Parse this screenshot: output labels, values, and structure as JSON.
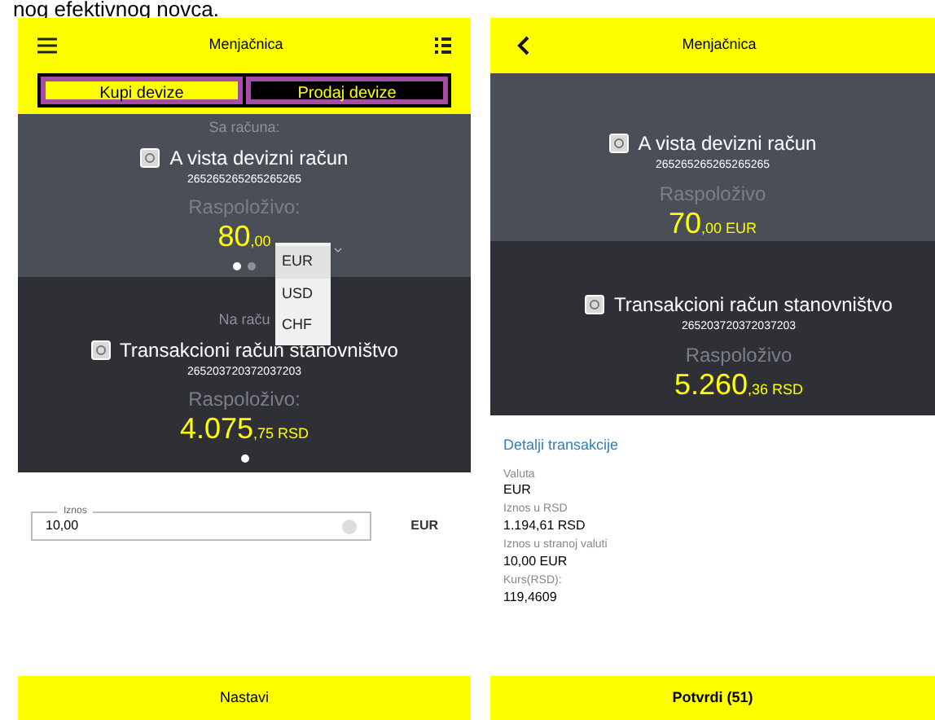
{
  "caption": "nog efektivnog novca.",
  "left": {
    "title": "Menjačnica",
    "tabs": [
      {
        "label": "Kupi devize",
        "selected": true
      },
      {
        "label": "Prodaj devize",
        "selected": false
      }
    ],
    "from": {
      "label": "Sa računa:",
      "name": "A vista devizni račun",
      "number": "265265265265265265",
      "available": "Raspoloživo:",
      "amount": "80",
      "decimals": ",00",
      "currency_dropdown": {
        "options": [
          {
            "label": "EUR",
            "selected": true
          },
          {
            "label": "USD",
            "selected": false
          },
          {
            "label": "CHF",
            "selected": false
          }
        ]
      },
      "pages": [
        {
          "selected": true
        },
        {
          "selected": false
        }
      ]
    },
    "to": {
      "label": "Na raču",
      "name": "Transakcioni račun stanovništvo",
      "number": "265203720372037203",
      "available": "Raspoloživo:",
      "amount": "4.075",
      "decimals": ",75 RSD",
      "pages": [
        {
          "selected": true
        }
      ]
    },
    "amount_field": {
      "label": "Iznos",
      "value": "10,00",
      "currency": "EUR"
    },
    "button": "Nastavi"
  },
  "right": {
    "title": "Menjačnica",
    "from": {
      "name": "A vista devizni račun",
      "number": "265265265265265265",
      "available": "Raspoloživo",
      "amount": "70",
      "decimals": ",00 EUR"
    },
    "to": {
      "name": "Transakcioni račun stanovništvo",
      "number": "265203720372037203",
      "available": "Raspoloživo",
      "amount": "5.260",
      "decimals": ",36 RSD"
    },
    "details_title": "Detalji transakcije",
    "details": [
      {
        "label": "Valuta",
        "value": "EUR"
      },
      {
        "label": "Iznos u RSD",
        "value": "1.194,61 RSD"
      },
      {
        "label": "Iznos u stranoj valuti",
        "value": "10,00 EUR"
      },
      {
        "label": "Kurs(RSD):",
        "value": "119,4609"
      }
    ],
    "button": "Potvrdi (51)"
  }
}
